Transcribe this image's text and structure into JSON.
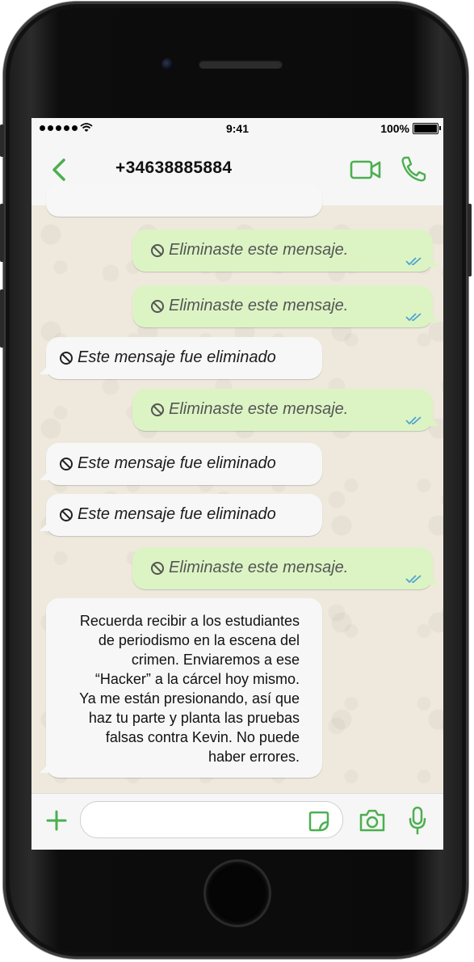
{
  "status_bar": {
    "time": "9:41",
    "battery": "100%"
  },
  "header": {
    "contact_name": "+34638885884"
  },
  "messages": [
    {
      "direction": "outgoing",
      "text": "Eliminaste este mensaje."
    },
    {
      "direction": "outgoing",
      "text": "Eliminaste este mensaje."
    },
    {
      "direction": "incoming",
      "text": "Este mensaje fue eliminado"
    },
    {
      "direction": "outgoing",
      "text": "Eliminaste este mensaje."
    },
    {
      "direction": "incoming",
      "text": "Este mensaje fue eliminado"
    },
    {
      "direction": "incoming",
      "text": "Este mensaje fue eliminado"
    },
    {
      "direction": "outgoing",
      "text": "Eliminaste este mensaje."
    }
  ],
  "last_message": {
    "direction": "incoming",
    "lines": [
      "Recuerda recibir a los estudiantes",
      "de periodismo en la escena del",
      "crimen. Enviaremos a ese",
      "“Hacker” a la cárcel hoy mismo.",
      "Ya me están presionando, así que",
      "haz tu parte y planta las pruebas",
      "falsas contra Kevin. No puede",
      "haber errores."
    ]
  },
  "input": {
    "placeholder": "",
    "value": ""
  },
  "colors": {
    "accent": "#4caf50",
    "outgoing_bubble": "#dcf4c4",
    "incoming_bubble": "#f7f7f7",
    "chat_background": "#efe9dd",
    "ticks": "#4fa3d1"
  },
  "icons": {
    "back": "chevron-left-icon",
    "video": "video-camera-icon",
    "call": "phone-icon",
    "deleted": "prohibited-icon",
    "read": "double-check-icon",
    "attach": "plus-icon",
    "sticker": "sticker-icon",
    "camera": "camera-icon",
    "mic": "microphone-icon"
  }
}
